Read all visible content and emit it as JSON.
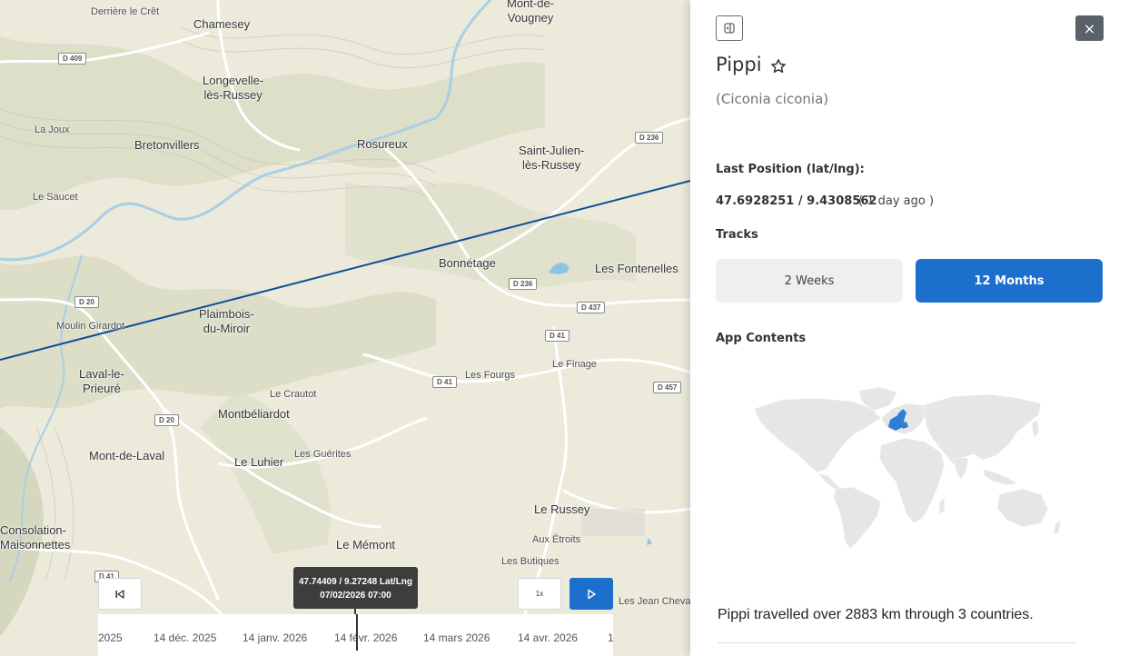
{
  "map": {
    "places": [
      {
        "name": "Derrière le Crêt",
        "size": "small"
      },
      {
        "name": "Chamesey",
        "size": "big"
      },
      {
        "name": "Mont-de-\nVougney",
        "size": "big"
      },
      {
        "name": "Longevelle-\nlès-Russey",
        "size": "big"
      },
      {
        "name": "La Joux",
        "size": "small"
      },
      {
        "name": "Bretonvillers",
        "size": "big"
      },
      {
        "name": "Rosureux",
        "size": "big"
      },
      {
        "name": "Saint-Julien-\nlès-Russey",
        "size": "big"
      },
      {
        "name": "Le Saucet",
        "size": "small"
      },
      {
        "name": "Bonnétage",
        "size": "big"
      },
      {
        "name": "Les Fontenelles",
        "size": "big"
      },
      {
        "name": "Moulin Girardot",
        "size": "small"
      },
      {
        "name": "Plaimbois-\ndu-Miroir",
        "size": "big"
      },
      {
        "name": "Laval-le-\nPrieuré",
        "size": "big"
      },
      {
        "name": "Les Fourgs",
        "size": "small"
      },
      {
        "name": "Le Finage",
        "size": "small"
      },
      {
        "name": "Le Crautot",
        "size": "small"
      },
      {
        "name": "Montbéliardot",
        "size": "big"
      },
      {
        "name": "Mont-de-Laval",
        "size": "big"
      },
      {
        "name": "Le Luhier",
        "size": "big"
      },
      {
        "name": "Les Guérites",
        "size": "small"
      },
      {
        "name": "Consolation-\nMaisonnettes",
        "size": "big"
      },
      {
        "name": "Le Russey",
        "size": "big"
      },
      {
        "name": "Aux Étroits",
        "size": "small"
      },
      {
        "name": "Le Mémont",
        "size": "big"
      },
      {
        "name": "Les Butiques",
        "size": "small"
      },
      {
        "name": "Les Jean Cheval",
        "size": "small"
      }
    ],
    "roads": [
      "D 409",
      "D 236",
      "D 20",
      "D 236",
      "D 437",
      "D 41",
      "D 41",
      "D 457",
      "D 20",
      "D 41"
    ]
  },
  "timeline": {
    "back_icon": "skip-back-icon",
    "speed_label": "1x",
    "play_icon": "play-icon",
    "tooltip_coords": "47.74409 / 9.27248 Lat/Lng",
    "tooltip_time": "07/02/2026 07:00",
    "ticks": [
      "2025",
      "14 déc. 2025",
      "14 janv. 2026",
      "14 févr. 2026",
      "14 mars 2026",
      "14 avr. 2026",
      "1"
    ]
  },
  "panel": {
    "toggle_icon": "panel-toggle-icon",
    "close_label": "×",
    "name": "Pippi",
    "star_icon": "star-outline-icon",
    "species": "(Ciconia ciconia)",
    "last_position_label": "Last Position (lat/lng):",
    "last_position_value": "47.6928251 / 9.4308562",
    "last_position_ago": "( 1 day ago )",
    "tracks_label": "Tracks",
    "tracks": [
      {
        "label": "2 Weeks",
        "active": false
      },
      {
        "label": "12 Months",
        "active": true
      }
    ],
    "app_contents_label": "App Contents",
    "summary": "Pippi travelled over 2883 km through 3 countries."
  },
  "colors": {
    "accent": "#1d6fce",
    "track_line": "#0d4d99",
    "map_bg": "#eceadb",
    "highlight_country": "#2e7dd7"
  }
}
